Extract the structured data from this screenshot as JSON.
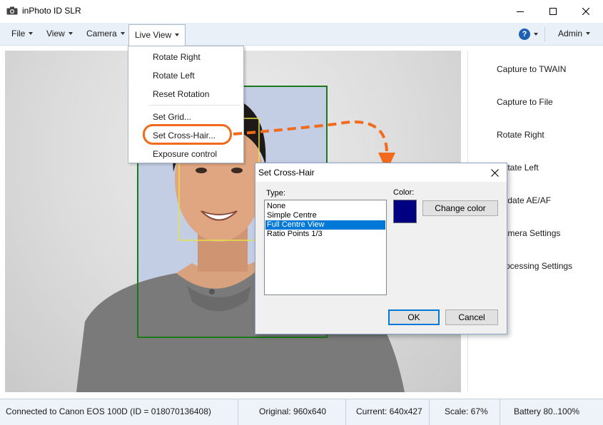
{
  "window": {
    "title": "inPhoto ID SLR",
    "icons": {
      "app": "camera-icon",
      "minimize": "minimize-icon",
      "maximize": "maximize-icon",
      "close": "close-icon"
    }
  },
  "menubar": {
    "items": [
      {
        "label": "File"
      },
      {
        "label": "View"
      },
      {
        "label": "Camera"
      },
      {
        "label": "Live View"
      }
    ],
    "help_icon_text": "?",
    "admin_label": "Admin"
  },
  "live_view_menu": {
    "items": [
      {
        "label": "Rotate Right"
      },
      {
        "label": "Rotate Left"
      },
      {
        "label": "Reset Rotation"
      },
      {
        "label": "Set Grid..."
      },
      {
        "label": "Set Cross-Hair..."
      },
      {
        "label": "Exposure control"
      }
    ],
    "highlight_color": "#f26a1b"
  },
  "side_panel": {
    "buttons": [
      {
        "label": "Capture to TWAIN"
      },
      {
        "label": "Capture to File"
      },
      {
        "label": "Rotate Right"
      },
      {
        "label": "Rotate Left"
      },
      {
        "label": "Update AE/AF"
      },
      {
        "label": "Camera Settings"
      },
      {
        "label": "Processing Settings"
      }
    ]
  },
  "dialog": {
    "title": "Set Cross-Hair",
    "type_label": "Type:",
    "color_label": "Color:",
    "types": [
      {
        "label": "None"
      },
      {
        "label": "Simple Centre"
      },
      {
        "label": "Full Centre View"
      },
      {
        "label": "Ratio Points 1/3"
      }
    ],
    "selected_type": "Full Centre View",
    "color_value": "#000080",
    "change_color_label": "Change color",
    "ok_label": "OK",
    "cancel_label": "Cancel"
  },
  "statusbar": {
    "connection": "Connected to Canon EOS 100D (ID = 018070136408)",
    "original": "Original: 960x640",
    "current": "Current: 640x427",
    "scale": "Scale: 67%",
    "battery": "Battery 80..100%"
  },
  "colors": {
    "accent": "#f26a1b",
    "selection": "#0078d7",
    "face_frame": "#1a7a1a",
    "head_frame": "#e6e24a"
  }
}
